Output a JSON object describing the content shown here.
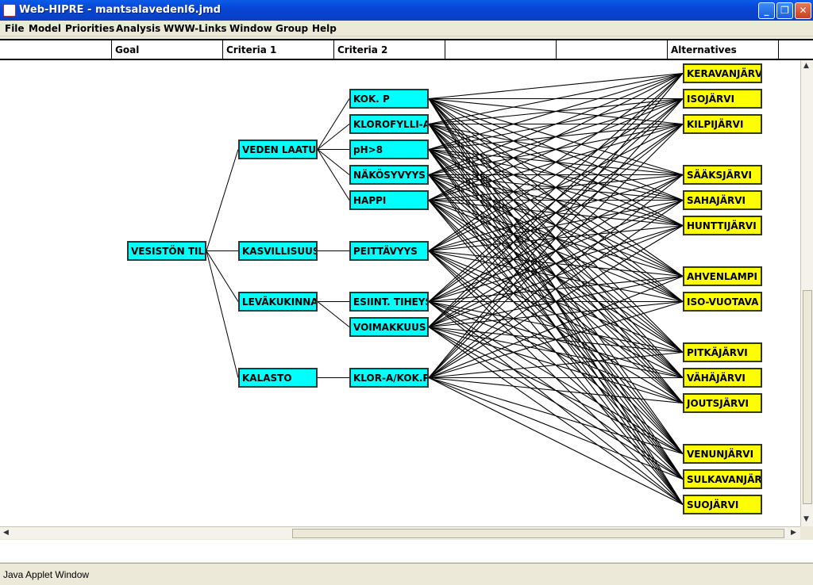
{
  "window": {
    "title": "Web-HIPRE - mantsalavedenl6.jmd",
    "minimize_label": "_",
    "maximize_label": "❐",
    "close_label": "✕"
  },
  "menu": [
    "File",
    "Model",
    "Priorities",
    "Analysis",
    "WWW-Links",
    "Window",
    "Group",
    "Help"
  ],
  "columns": [
    "",
    "Goal",
    "Criteria 1",
    "Criteria 2",
    "",
    "",
    "Alternatives",
    ""
  ],
  "hierarchy": {
    "goal": "VESISTÖN TILA",
    "criteria1": [
      "VEDEN LAATU",
      "KASVILLISUUS",
      "LEVÄKUKINNAT",
      "KALASTO"
    ],
    "criteria2": [
      "KOK. P",
      "KLOROFYLLI-A",
      "pH>8",
      "NÄKÖSYVYYS",
      "HAPPI",
      "PEITTÄVYYS",
      "ESIINT. TIHEYS",
      "VOIMAKKUUS",
      "KLOR-A/KOK.P"
    ],
    "criteria2_parent": [
      0,
      0,
      0,
      0,
      0,
      1,
      2,
      2,
      3
    ],
    "alternatives": [
      "KERAVANJÄRVI",
      "ISOJÄRVI",
      "KILPIJÄRVI",
      "SÄÄKSJÄRVI",
      "SAHAJÄRVI",
      "HUNTTIJÄRVI",
      "AHVENLAMPI",
      "ISO-VUOTAVA",
      "PITKÄJÄRVI",
      "VÄHÄJÄRVI",
      "JOUTSJÄRVI",
      "VENUNJÄRVI",
      "SULKAVANJÄR",
      "SUOJÄRVI"
    ]
  },
  "colors": {
    "criteria_node": "#00ffff",
    "alternative_node": "#ffff00"
  },
  "status": "Java Applet Window"
}
